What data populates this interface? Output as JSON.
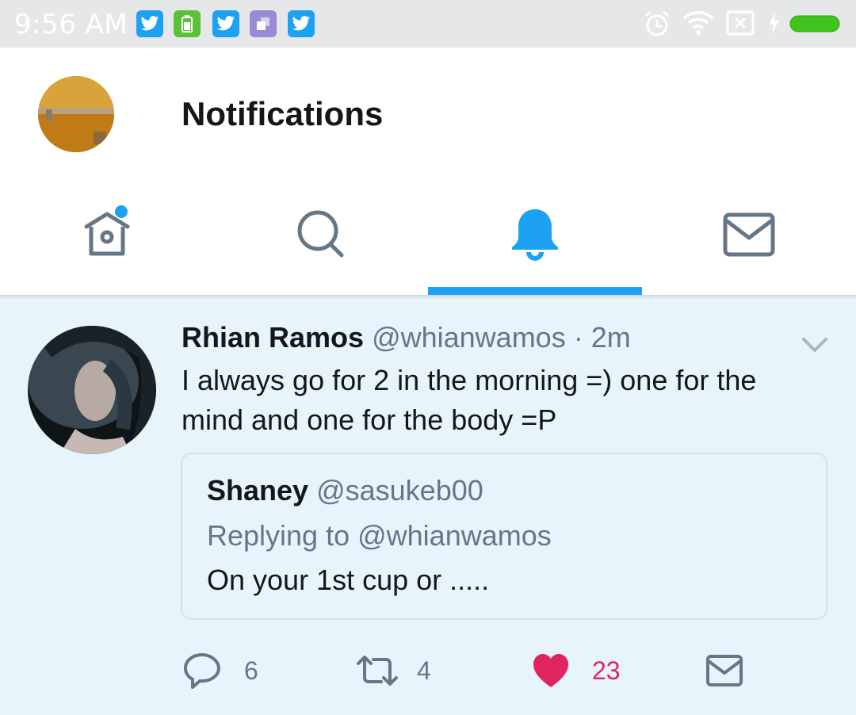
{
  "status_bar": {
    "time": "9:56 AM",
    "notification_icons": [
      "twitter-icon",
      "battery-app-icon",
      "twitter-icon",
      "app-icon",
      "twitter-icon"
    ],
    "right_icons": [
      "alarm-icon",
      "wifi-icon",
      "no-sim-icon",
      "charging-icon",
      "battery-icon"
    ]
  },
  "header": {
    "title": "Notifications",
    "tabs": [
      {
        "name": "home",
        "icon": "home-icon",
        "has_badge": true
      },
      {
        "name": "search",
        "icon": "search-icon"
      },
      {
        "name": "notifications",
        "icon": "bell-icon",
        "active": true
      },
      {
        "name": "messages",
        "icon": "mail-icon"
      }
    ]
  },
  "tweet": {
    "author_name": "Rhian Ramos",
    "author_handle": "@whianwamos",
    "separator": "·",
    "time": "2m",
    "text": "I always go for 2 in the morning =) one for the mind and one for the body =P",
    "quote": {
      "name": "Shaney",
      "handle": "@sasukeb00",
      "replying_to": "Replying to @whianwamos",
      "text": "On your 1st cup or ....."
    },
    "actions": {
      "replies": "6",
      "retweets": "4",
      "likes": "23",
      "liked": true
    }
  },
  "colors": {
    "accent": "#1da1f2",
    "like": "#e0245e",
    "icon_gray": "#657786",
    "background": "#e8f4fb"
  }
}
